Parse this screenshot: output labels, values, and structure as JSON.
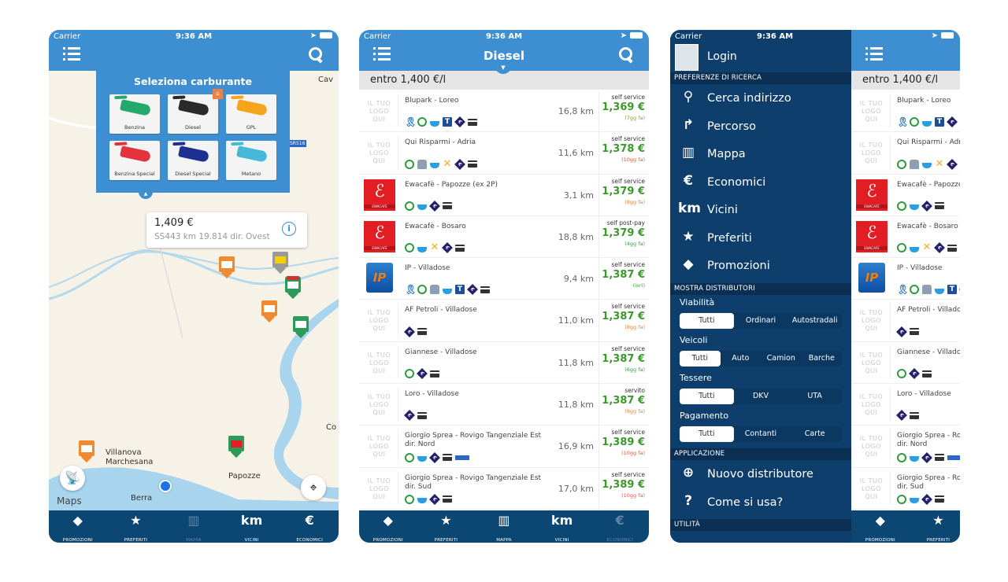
{
  "status": {
    "carrier": "Carrier",
    "time": "9:36 AM"
  },
  "colors": {
    "header_blue": "#3d8fd1",
    "tabbar_navy": "#0c4673",
    "menu_navy": "#0e3e6b",
    "price_green": "#3a9a2a"
  },
  "tabs": [
    {
      "label": "PROMOZIONI",
      "icon": "tag-icon"
    },
    {
      "label": "PREFERITI",
      "icon": "star-box-icon"
    },
    {
      "label": "MAPPA",
      "icon": "map-icon"
    },
    {
      "label": "VICINI",
      "icon": "km-icon"
    },
    {
      "label": "ECONOMICI",
      "icon": "euro-icon"
    }
  ],
  "map_screen": {
    "fuel_picker": {
      "title": "Seleziona carburante",
      "options": [
        {
          "label": "Benzina",
          "color": "#25a86b",
          "favorite": false
        },
        {
          "label": "Diesel",
          "color": "#2a2a2a",
          "favorite": true
        },
        {
          "label": "GPL",
          "color": "#f4a51c",
          "favorite": false
        },
        {
          "label": "Benzina Special",
          "color": "#e2333f",
          "favorite": false
        },
        {
          "label": "Diesel Special",
          "color": "#1d2f8f",
          "favorite": false
        },
        {
          "label": "Metano",
          "color": "#46b8d8",
          "favorite": false
        }
      ]
    },
    "callout": {
      "price": "1,409 €",
      "subtitle": "SS443 km 19.814 dir. Ovest"
    },
    "places": [
      "Cav",
      "Villanova\nMarchesana",
      "Papozze",
      "Berra",
      "Co"
    ],
    "road_badge": "SR516",
    "legal": "Maps"
  },
  "list_screen": {
    "title": "Diesel",
    "filter": "entro 1,400 €/l",
    "logo_placeholder": "IL TUO\nLOGO\nQUI",
    "rows": [
      {
        "name": "Blupark - Loreo",
        "logo": "placeholder",
        "amenities": [
          "award",
          "clock",
          "cafe",
          "t",
          "e",
          "card"
        ],
        "distance": "16,8 km",
        "service": "self service",
        "price": "1,369 €",
        "age": "(7gg fa)",
        "age_color": "#8a9a2a"
      },
      {
        "name": "Qui Risparmi - Adria",
        "logo": "placeholder",
        "amenities": [
          "clock",
          "carwash",
          "cafe",
          "tools",
          "e",
          "card"
        ],
        "distance": "11,6 km",
        "service": "self service",
        "price": "1,378 €",
        "age": "(10gg fa)",
        "age_color": "#e0553a"
      },
      {
        "name": "Ewacafè - Papozze (ex 2P)",
        "logo": "ewacafe",
        "amenities": [
          "clock",
          "cafe",
          "e",
          "card"
        ],
        "distance": "3,1 km",
        "service": "self service",
        "price": "1,379 €",
        "age": "(8gg fa)",
        "age_color": "#e0823a"
      },
      {
        "name": "Ewacafè - Bosaro",
        "logo": "ewacafe",
        "amenities": [
          "clock",
          "cafe",
          "tools",
          "e",
          "card"
        ],
        "distance": "18,8 km",
        "service": "self post-pay",
        "price": "1,379 €",
        "age": "(4gg fa)",
        "age_color": "#3a9a3a"
      },
      {
        "name": "IP - Villadose",
        "logo": "ip",
        "amenities": [
          "award",
          "clock",
          "carwash",
          "cafe",
          "t",
          "e",
          "card"
        ],
        "distance": "9,4 km",
        "service": "self service",
        "price": "1,387 €",
        "age": "(ieri)",
        "age_color": "#3a9a3a"
      },
      {
        "name": "AF Petroli - Villadose",
        "logo": "placeholder",
        "amenities": [
          "e",
          "card"
        ],
        "distance": "11,0 km",
        "service": "self service",
        "price": "1,387 €",
        "age": "(8gg fa)",
        "age_color": "#e0823a"
      },
      {
        "name": "Giannese - Villadose",
        "logo": "placeholder",
        "amenities": [
          "clock",
          "e",
          "card"
        ],
        "distance": "11,8 km",
        "service": "self service",
        "price": "1,387 €",
        "age": "(6gg fa)",
        "age_color": "#3a9a3a"
      },
      {
        "name": "Loro - Villadose",
        "logo": "placeholder",
        "amenities": [
          "e",
          "card"
        ],
        "distance": "11,8 km",
        "service": "servito",
        "price": "1,387 €",
        "age": "(9gg fa)",
        "age_color": "#e0823a"
      },
      {
        "name": "Giorgio Sprea - Rovigo Tangenziale Est dir. Nord",
        "logo": "placeholder",
        "amenities": [
          "clock",
          "cafe",
          "e",
          "card",
          "bancomat"
        ],
        "distance": "16,9 km",
        "service": "self service",
        "price": "1,389 €",
        "age": "(10gg fa)",
        "age_color": "#e0553a"
      },
      {
        "name": "Giorgio Sprea - Rovigo Tangenziale Est dir. Sud",
        "logo": "placeholder",
        "amenities": [
          "clock",
          "cafe",
          "e",
          "card"
        ],
        "distance": "17,0 km",
        "service": "self service",
        "price": "1,389 €",
        "age": "(10gg fa)",
        "age_color": "#e0553a"
      }
    ]
  },
  "menu": {
    "login": "Login",
    "sections": {
      "search": "PREFERENZE DI RICERCA",
      "show": "MOSTRA DISTRIBUTORI",
      "app": "APPLICAZIONE",
      "utility": "UTILITÀ"
    },
    "search_items": [
      {
        "label": "Cerca indirizzo",
        "icon": "search-icon",
        "glyph": "⚲"
      },
      {
        "label": "Percorso",
        "icon": "route-icon",
        "glyph": "↱"
      },
      {
        "label": "Mappa",
        "icon": "map-icon",
        "glyph": "▥"
      },
      {
        "label": "Economici",
        "icon": "euro-icon",
        "glyph": "€"
      },
      {
        "label": "Vicini",
        "icon": "km-icon",
        "glyph": "km"
      },
      {
        "label": "Preferiti",
        "icon": "star-box-icon",
        "glyph": "★"
      },
      {
        "label": "Promozioni",
        "icon": "tag-icon",
        "glyph": "◆"
      }
    ],
    "filters": [
      {
        "label": "Viabilità",
        "options": [
          "Tutti",
          "Ordinari",
          "Autostradali"
        ],
        "selected": "Tutti"
      },
      {
        "label": "Veicoli",
        "options": [
          "Tutti",
          "Auto",
          "Camion",
          "Barche"
        ],
        "selected": "Tutti"
      },
      {
        "label": "Tessere",
        "options": [
          "Tutti",
          "DKV",
          "UTA"
        ],
        "selected": "Tutti"
      },
      {
        "label": "Pagamento",
        "options": [
          "Tutti",
          "Contanti",
          "Carte"
        ],
        "selected": "Tutti"
      }
    ],
    "app_items": [
      {
        "label": "Nuovo distributore",
        "icon": "plus-circle-icon",
        "glyph": "⊕"
      },
      {
        "label": "Come si usa?",
        "icon": "help-icon",
        "glyph": "?"
      }
    ]
  }
}
